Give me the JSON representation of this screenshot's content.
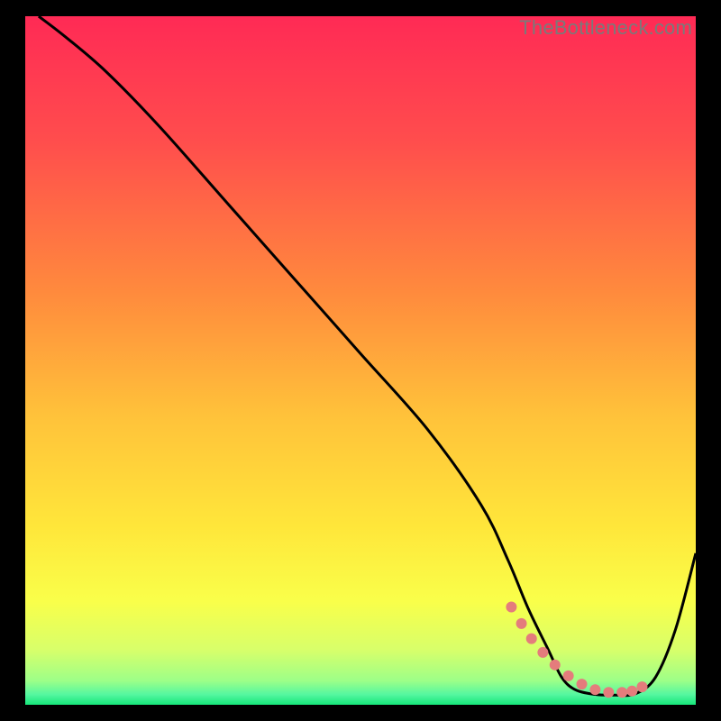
{
  "watermark": "TheBottleneck.com",
  "chart_data": {
    "type": "line",
    "title": "",
    "xlabel": "",
    "ylabel": "",
    "xlim": [
      0,
      100
    ],
    "ylim": [
      0,
      100
    ],
    "gradient_stops": [
      {
        "offset": 0.0,
        "color": "#ff2a55"
      },
      {
        "offset": 0.18,
        "color": "#ff4d4d"
      },
      {
        "offset": 0.4,
        "color": "#ff8a3d"
      },
      {
        "offset": 0.58,
        "color": "#ffc23a"
      },
      {
        "offset": 0.74,
        "color": "#ffe63a"
      },
      {
        "offset": 0.85,
        "color": "#f9ff4a"
      },
      {
        "offset": 0.92,
        "color": "#d8ff6a"
      },
      {
        "offset": 0.965,
        "color": "#9dff88"
      },
      {
        "offset": 0.985,
        "color": "#55f7a0"
      },
      {
        "offset": 1.0,
        "color": "#16e67a"
      }
    ],
    "series": [
      {
        "name": "bottleneck-curve",
        "color": "#000000",
        "x": [
          2,
          6,
          12,
          20,
          30,
          40,
          50,
          60,
          68,
          72,
          75,
          78,
          80,
          82,
          85,
          88,
          91,
          94,
          97,
          100
        ],
        "y": [
          100,
          97,
          92,
          84,
          73,
          62,
          51,
          40,
          29,
          21,
          14,
          8,
          4,
          2.2,
          1.5,
          1.4,
          1.6,
          4,
          11,
          22
        ]
      }
    ],
    "markers": {
      "name": "optimal-range",
      "color": "#e47c7c",
      "radius": 6,
      "x": [
        72.5,
        74,
        75.5,
        77.2,
        79,
        81,
        83,
        85,
        87,
        89,
        90.5,
        92
      ],
      "y": [
        14.2,
        11.8,
        9.6,
        7.6,
        5.8,
        4.2,
        3.0,
        2.2,
        1.8,
        1.8,
        2.0,
        2.6
      ]
    }
  }
}
